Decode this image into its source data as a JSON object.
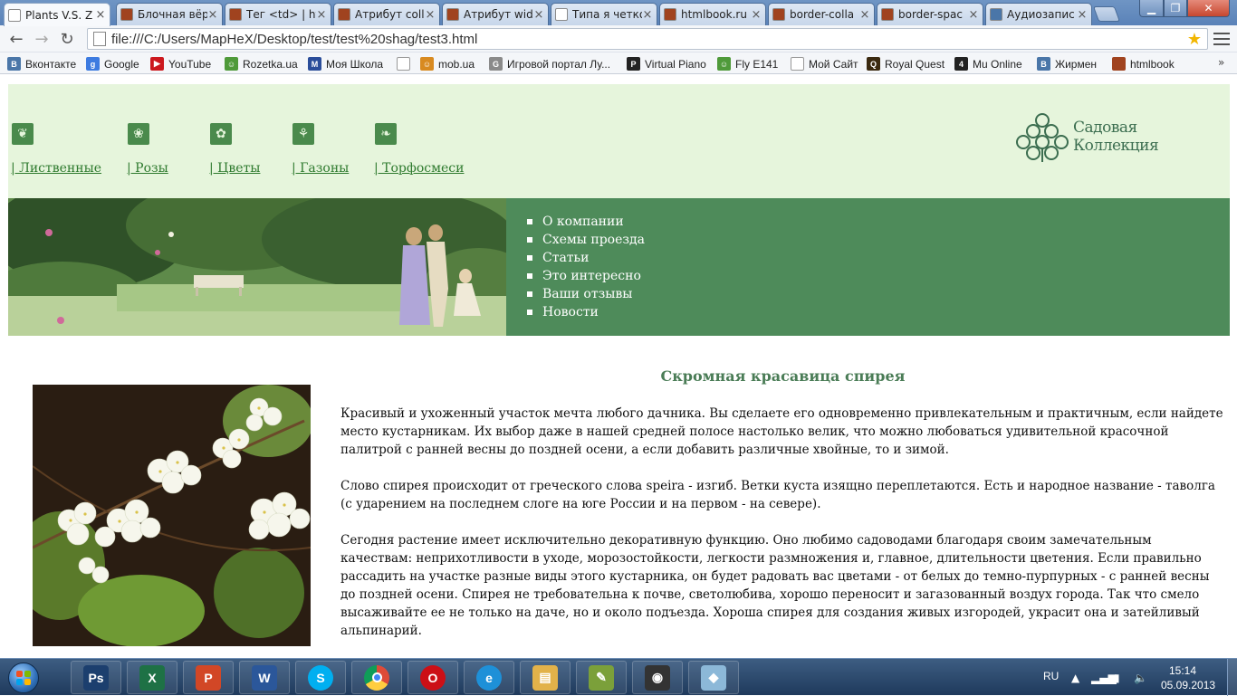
{
  "browser": {
    "tabs": [
      {
        "label": "Plants V.S. Z",
        "icon_color": "#ffffff",
        "active": true
      },
      {
        "label": "Блочная вёр",
        "icon_color": "#a0431f",
        "active": false
      },
      {
        "label": "Тег <td> | ht",
        "icon_color": "#a0431f",
        "active": false
      },
      {
        "label": "Атрибут coll",
        "icon_color": "#a0431f",
        "active": false
      },
      {
        "label": "Атрибут wid",
        "icon_color": "#a0431f",
        "active": false
      },
      {
        "label": "Типа я четко",
        "icon_color": "#ffffff",
        "active": false
      },
      {
        "label": "htmlbook.ru",
        "icon_color": "#a0431f",
        "active": false
      },
      {
        "label": "border-colla",
        "icon_color": "#a0431f",
        "active": false
      },
      {
        "label": "border-spac",
        "icon_color": "#a0431f",
        "active": false
      },
      {
        "label": "Аудиозапис",
        "icon_color": "#4a76a8",
        "active": false
      }
    ],
    "url": "file:///C:/Users/MapHeX/Desktop/test/test%20shag/test3.html",
    "bookmarks": [
      {
        "label": "Вконтакте",
        "icon": "vk-icon",
        "color": "#4a76a8",
        "glyph": "B"
      },
      {
        "label": "Google",
        "icon": "google-icon",
        "color": "#3d7be0",
        "glyph": "g"
      },
      {
        "label": "YouTube",
        "icon": "youtube-icon",
        "color": "#cc181e",
        "glyph": "▶"
      },
      {
        "label": "Rozetka.ua",
        "icon": "rozetka-icon",
        "color": "#4f9a3a",
        "glyph": "☺"
      },
      {
        "label": "Моя Школа",
        "icon": "school-icon",
        "color": "#2a4d9a",
        "glyph": "M"
      },
      {
        "label": "",
        "icon": "page-icon",
        "color": "#ffffff",
        "glyph": ""
      },
      {
        "label": "mob.ua",
        "icon": "mob-icon",
        "color": "#d88a20",
        "glyph": "☺"
      },
      {
        "label": "Игровой портал Лу...",
        "icon": "gp-icon",
        "color": "#8a8a8a",
        "glyph": "G"
      },
      {
        "label": "Virtual Piano",
        "icon": "piano-icon",
        "color": "#222222",
        "glyph": "P"
      },
      {
        "label": "Fly E141",
        "icon": "fly-icon",
        "color": "#4f9a3a",
        "glyph": "☺"
      },
      {
        "label": "Мой Сайт",
        "icon": "page-icon",
        "color": "#ffffff",
        "glyph": ""
      },
      {
        "label": "Royal Quest",
        "icon": "royalquest-icon",
        "color": "#3b2a10",
        "glyph": "Q"
      },
      {
        "label": "Mu Online",
        "icon": "muonline-icon",
        "color": "#222222",
        "glyph": "4"
      },
      {
        "label": "Жирмен",
        "icon": "vk-icon",
        "color": "#4a76a8",
        "glyph": "B"
      },
      {
        "label": "htmlbook",
        "icon": "htmlbook-icon",
        "color": "#a0431f",
        "glyph": ""
      }
    ],
    "bookmarks_more": "»"
  },
  "site": {
    "categories": [
      {
        "label": "| Лиственные",
        "icon": "leaf-branch-icon",
        "glyph": "❦"
      },
      {
        "label": "| Розы",
        "icon": "rose-icon",
        "glyph": "❀"
      },
      {
        "label": "| Цветы",
        "icon": "flower-icon",
        "glyph": "✿"
      },
      {
        "label": "| Газоны",
        "icon": "lawn-icon",
        "glyph": "⚘"
      },
      {
        "label": "| Торфосмеси",
        "icon": "peat-icon",
        "glyph": "❧"
      }
    ],
    "logo_text": "Садовая Коллекция",
    "menu": [
      "О компании",
      "Схемы проезда",
      "Статьи",
      "Это интересно",
      "Ваши отзывы",
      "Новости"
    ],
    "colors": {
      "header_bg": "#e6f5dc",
      "banner_bg": "#4e8b5a",
      "link": "#2e7a2e",
      "title": "#4a7c56"
    },
    "article": {
      "title": "Скромная красавица спирея",
      "paragraphs": [
        "Красивый и ухоженный участок мечта любого дачника. Вы сделаете его одновременно привлекательным и практичным, если найдете место кустарникам. Их выбор даже в нашей средней полосе настолько велик, что можно любоваться удивительной красочной палитрой с ранней весны до поздней осени, а если добавить различные хвойные, то и зимой.",
        "Слово спирея происходит от греческого слова speira - изгиб. Ветки куста изящно переплетаются. Есть и народное название - таволга (с ударением на последнем слоге на юге России и на первом - на севере).",
        "Сегодня растение имеет исключительно декоративную функцию. Оно любимо садоводами благодаря своим замечательным качествам: неприхотливости в уходе, морозостойкости, легкости размножения и, главное, длительности цветения. Если правильно рассадить на участке разные виды этого кустарника, он будет радовать вас цветами - от белых до темно-пурпурных - с ранней весны до поздней осени. Спирея не требовательна к почве, светолюбива, хорошо переносит и загазованный воздух города. Так что смело высаживайте ее не только на даче, но и около подъезда. Хороша спирея для создания живых изгородей, украсит она и затейливый альпинарий."
      ]
    }
  },
  "taskbar": {
    "apps": [
      {
        "name": "photoshop",
        "glyph": "Ps",
        "color": "#1c3f6e"
      },
      {
        "name": "excel",
        "glyph": "X",
        "color": "#1e7145"
      },
      {
        "name": "powerpoint",
        "glyph": "P",
        "color": "#d24726"
      },
      {
        "name": "word",
        "glyph": "W",
        "color": "#2b579a"
      },
      {
        "name": "skype",
        "glyph": "S",
        "color": "#00aff0"
      },
      {
        "name": "chrome",
        "glyph": "",
        "color": "#dd4b39"
      },
      {
        "name": "opera",
        "glyph": "O",
        "color": "#cc0f16"
      },
      {
        "name": "internet-explorer",
        "glyph": "e",
        "color": "#1e90d8"
      },
      {
        "name": "explorer",
        "glyph": "▤",
        "color": "#e2b24a"
      },
      {
        "name": "notepad-plus",
        "glyph": "✎",
        "color": "#7ba03a"
      },
      {
        "name": "camera-app",
        "glyph": "◉",
        "color": "#333333"
      },
      {
        "name": "app-unknown",
        "glyph": "◆",
        "color": "#8cb8d8"
      }
    ],
    "language": "RU",
    "time": "15:14",
    "date": "05.09.2013"
  }
}
